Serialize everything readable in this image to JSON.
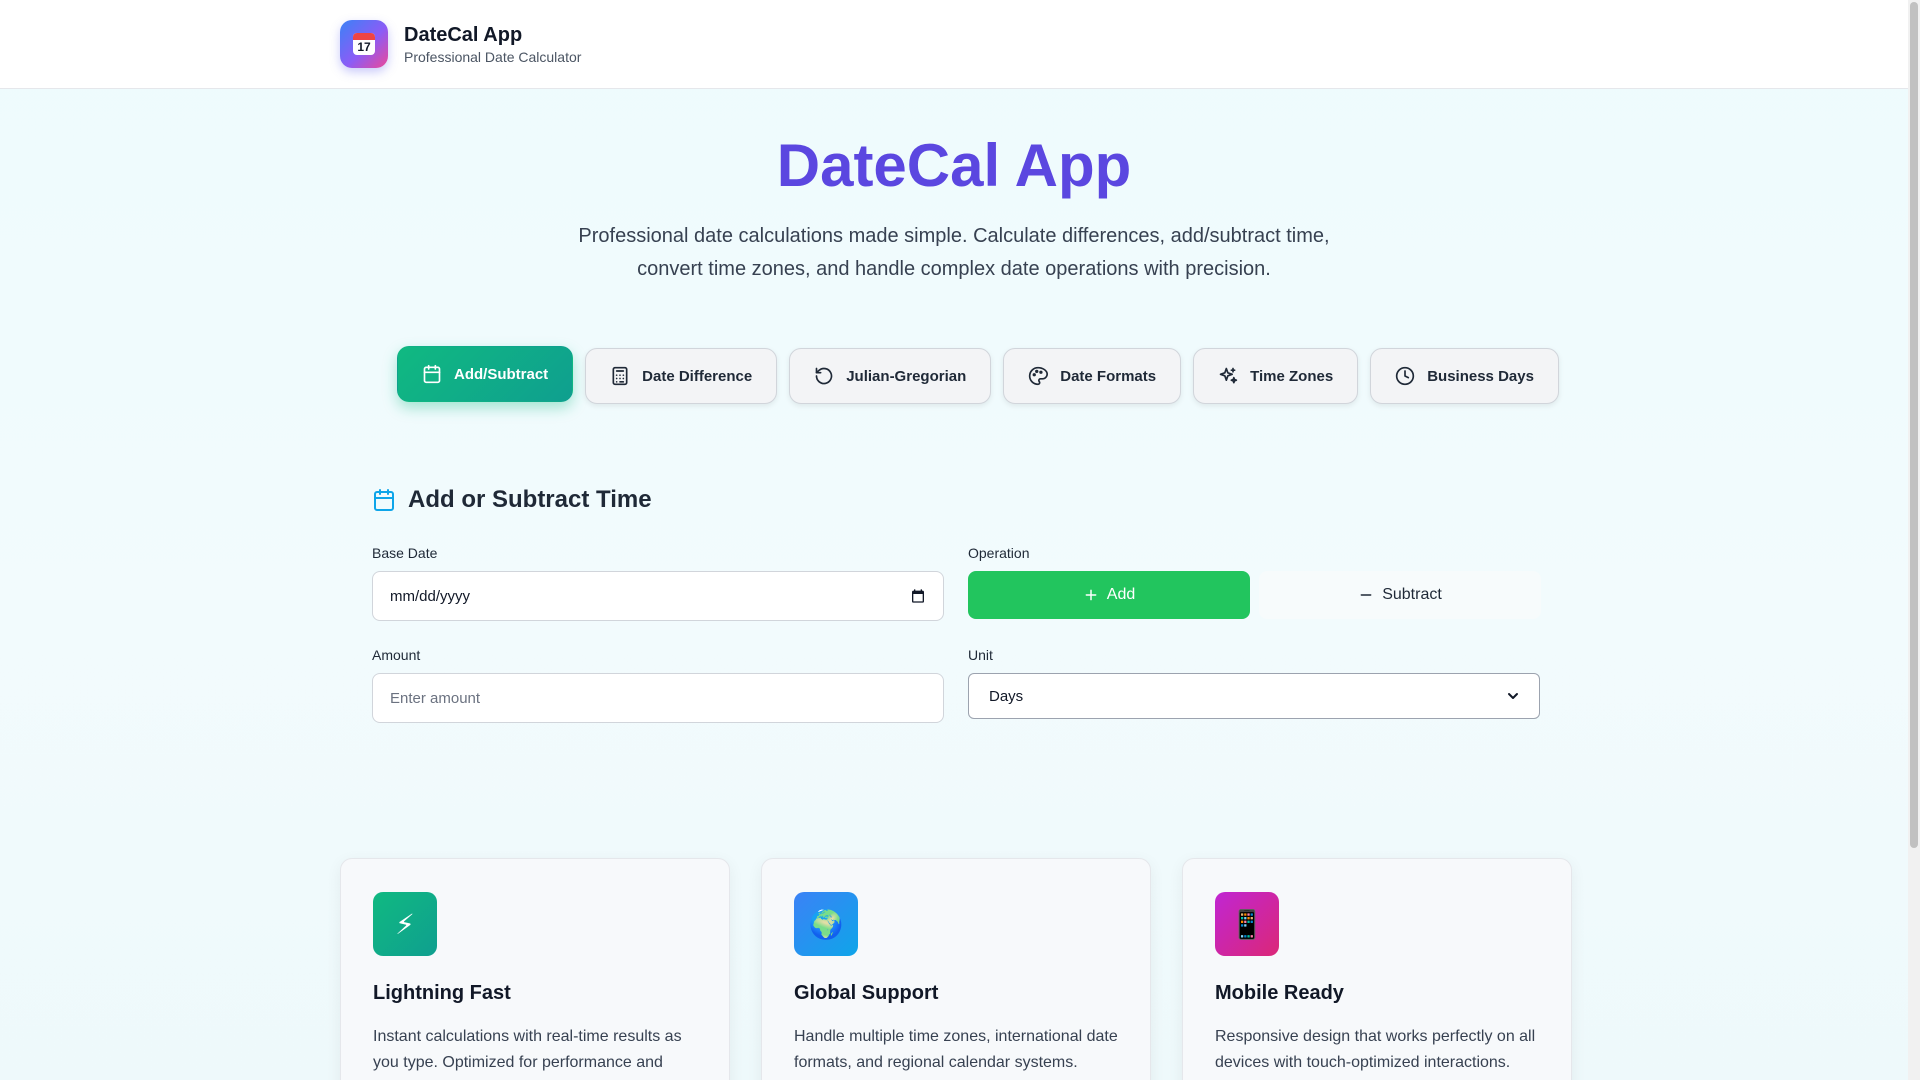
{
  "header": {
    "app_name": "DateCal App",
    "tagline": "Professional Date Calculator",
    "logo_day": "17"
  },
  "hero": {
    "title": "DateCal App",
    "description": "Professional date calculations made simple. Calculate differences, add/subtract time, convert time zones, and handle complex date operations with precision."
  },
  "tabs": [
    {
      "label": "Add/Subtract",
      "icon": "calendar-icon",
      "active": true
    },
    {
      "label": "Date Difference",
      "icon": "calculator-icon",
      "active": false
    },
    {
      "label": "Julian-Gregorian",
      "icon": "rotate-icon",
      "active": false
    },
    {
      "label": "Date Formats",
      "icon": "palette-icon",
      "active": false
    },
    {
      "label": "Time Zones",
      "icon": "sparkles-icon",
      "active": false
    },
    {
      "label": "Business Days",
      "icon": "clock-icon",
      "active": false
    }
  ],
  "form": {
    "title": "Add or Subtract Time",
    "base_date": {
      "label": "Base Date",
      "placeholder": "mm/dd/yyyy"
    },
    "operation": {
      "label": "Operation",
      "add_label": "Add",
      "subtract_label": "Subtract",
      "selected": "Add"
    },
    "amount": {
      "label": "Amount",
      "placeholder": "Enter amount"
    },
    "unit": {
      "label": "Unit",
      "selected": "Days"
    }
  },
  "features": [
    {
      "icon": "⚡",
      "icon_name": "lightning-icon",
      "title": "Lightning Fast",
      "description": "Instant calculations with real-time results as you type. Optimized for performance and",
      "color": "#10b981"
    },
    {
      "icon": "🌍",
      "icon_name": "globe-icon",
      "title": "Global Support",
      "description": "Handle multiple time zones, international date formats, and regional calendar systems.",
      "color": "#3b82f6"
    },
    {
      "icon": "📱",
      "icon_name": "mobile-icon",
      "title": "Mobile Ready",
      "description": "Responsive design that works perfectly on all devices with touch-optimized interactions.",
      "color": "#c026d3"
    }
  ],
  "colors": {
    "accent_green": "#22c55e",
    "tab_active": "#10b981",
    "hero_title": "#5b47e0",
    "icon_blue": "#0ea5e9"
  }
}
